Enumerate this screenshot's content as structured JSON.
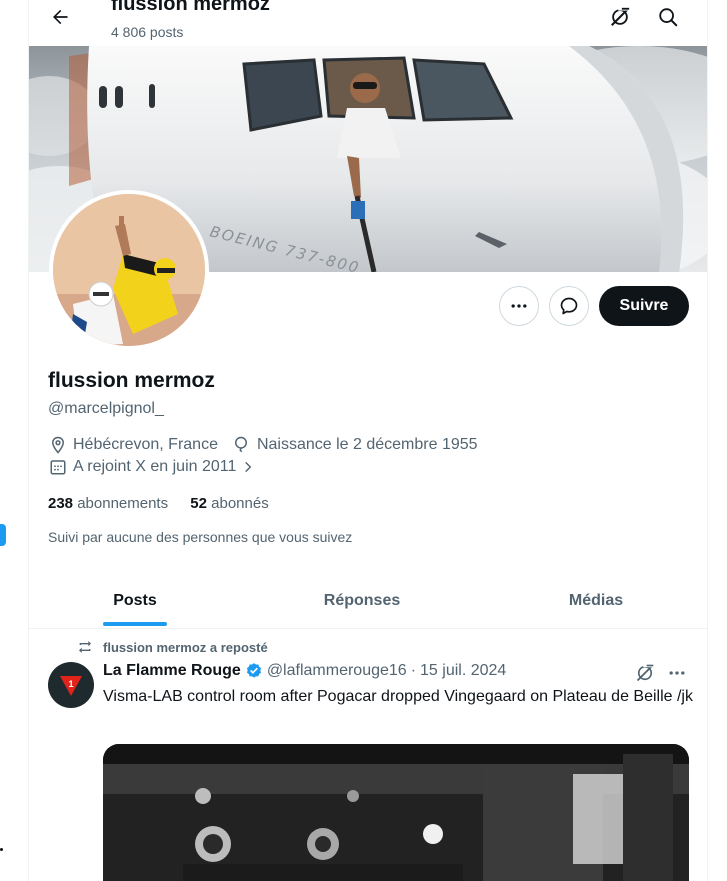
{
  "header": {
    "title": "flussion mermoz",
    "posts_count": "4 806 posts",
    "icons": [
      "back-arrow-icon",
      "grok-icon",
      "search-icon"
    ]
  },
  "profile": {
    "display_name": "flussion mermoz",
    "handle": "@marcelpignol_",
    "location": "Hébécrevon, France",
    "birth": "Naissance le 2 décembre 1955",
    "joined": "A rejoint X en juin 2011",
    "following_count": "238",
    "following_label": "abonnements",
    "followers_count": "52",
    "followers_label": "abonnés",
    "followed_by": "Suivi par aucune des personnes que vous suivez"
  },
  "actions": {
    "follow_label": "Suivre",
    "icons": [
      "more-icon",
      "message-icon"
    ]
  },
  "tabs": [
    {
      "label": "Posts",
      "active": true
    },
    {
      "label": "Réponses",
      "active": false
    },
    {
      "label": "Médias",
      "active": false
    }
  ],
  "post": {
    "repost_label": "flussion mermoz a reposté",
    "author": "La Flamme Rouge",
    "handle": "@laflammerouge16",
    "separator": "·",
    "date": "15 juil. 2024",
    "text": "Visma-LAB control room after Pogacar dropped Vingegaard on Plateau de Beille /jk",
    "avatar_text": "1"
  },
  "colors": {
    "accent": "#1d9bf0",
    "text_primary": "#0f1419",
    "text_secondary": "#536471",
    "follow_button": "#0f1419",
    "border": "#cfd9de",
    "flamme_rouge_red": "#e2231a",
    "jersey_yellow": "#f3d21b"
  }
}
